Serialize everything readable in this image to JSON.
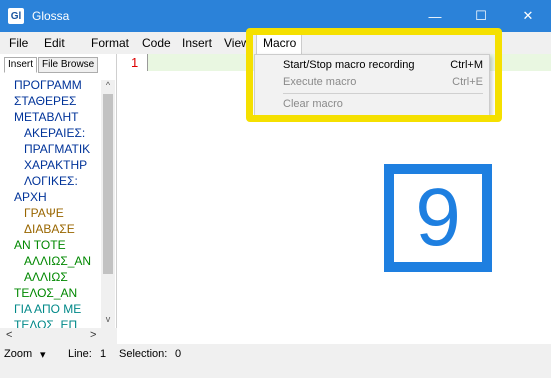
{
  "window": {
    "app_logo": "Gl",
    "title": "Glossa",
    "minimize": "—",
    "maximize": "☐",
    "close": "✕"
  },
  "menubar": {
    "items": [
      "File",
      "Edit",
      "Format",
      "Code",
      "Insert",
      "View",
      "Macro"
    ]
  },
  "macro_menu": {
    "items": [
      {
        "label": "Start/Stop macro recording",
        "shortcut": "Ctrl+M",
        "enabled": true
      },
      {
        "label": "Execute macro",
        "shortcut": "Ctrl+E",
        "enabled": false
      },
      {
        "label": "Clear macro",
        "shortcut": "",
        "enabled": false
      }
    ]
  },
  "side_panel": {
    "tabs": [
      "Insert",
      "File Browse"
    ],
    "active_tab": "Insert",
    "tree": [
      {
        "label": "ΠΡΟΓΡΑΜΜ",
        "color": "#003399"
      },
      {
        "label": "ΣΤΑΘΕΡΕΣ",
        "color": "#003399"
      },
      {
        "label": "ΜΕΤΑΒΛΗΤ",
        "color": "#003399"
      },
      {
        "label": "ΑΚΕΡΑΙΕΣ:",
        "color": "#003399"
      },
      {
        "label": "ΠΡΑΓΜΑΤΙΚ",
        "color": "#003399"
      },
      {
        "label": "ΧΑΡΑΚΤΗΡ",
        "color": "#003399"
      },
      {
        "label": "ΛΟΓΙΚΕΣ:",
        "color": "#003399"
      },
      {
        "label": "ΑΡΧΗ",
        "color": "#003399"
      },
      {
        "label": "ΓΡΑΨΕ",
        "color": "#996600"
      },
      {
        "label": "ΔΙΑΒΑΣΕ",
        "color": "#996600"
      },
      {
        "label": "ΑΝ ΤΟΤΕ",
        "color": "#008800"
      },
      {
        "label": "ΑΛΛΙΩΣ_ΑΝ",
        "color": "#008800"
      },
      {
        "label": "ΑΛΛΙΩΣ",
        "color": "#008800"
      },
      {
        "label": "ΤΕΛΟΣ_ΑΝ",
        "color": "#008800"
      },
      {
        "label": "ΓΙΑ ΑΠΟ ΜΕ",
        "color": "#008888"
      },
      {
        "label": "ΤΕΛΟΣ_ΕΠ",
        "color": "#008888"
      }
    ]
  },
  "editor": {
    "line_number": "1"
  },
  "statusbar": {
    "zoom": "Zoom",
    "zoom_caret": "▾",
    "line_label": "Line:",
    "line_value": "1",
    "selection_label": "Selection:",
    "selection_value": "0"
  },
  "overlay_badge": "9",
  "colors": {
    "titlebar": "#2b82d9",
    "highlight": "#f5e000",
    "badge": "#1e7fe0"
  }
}
